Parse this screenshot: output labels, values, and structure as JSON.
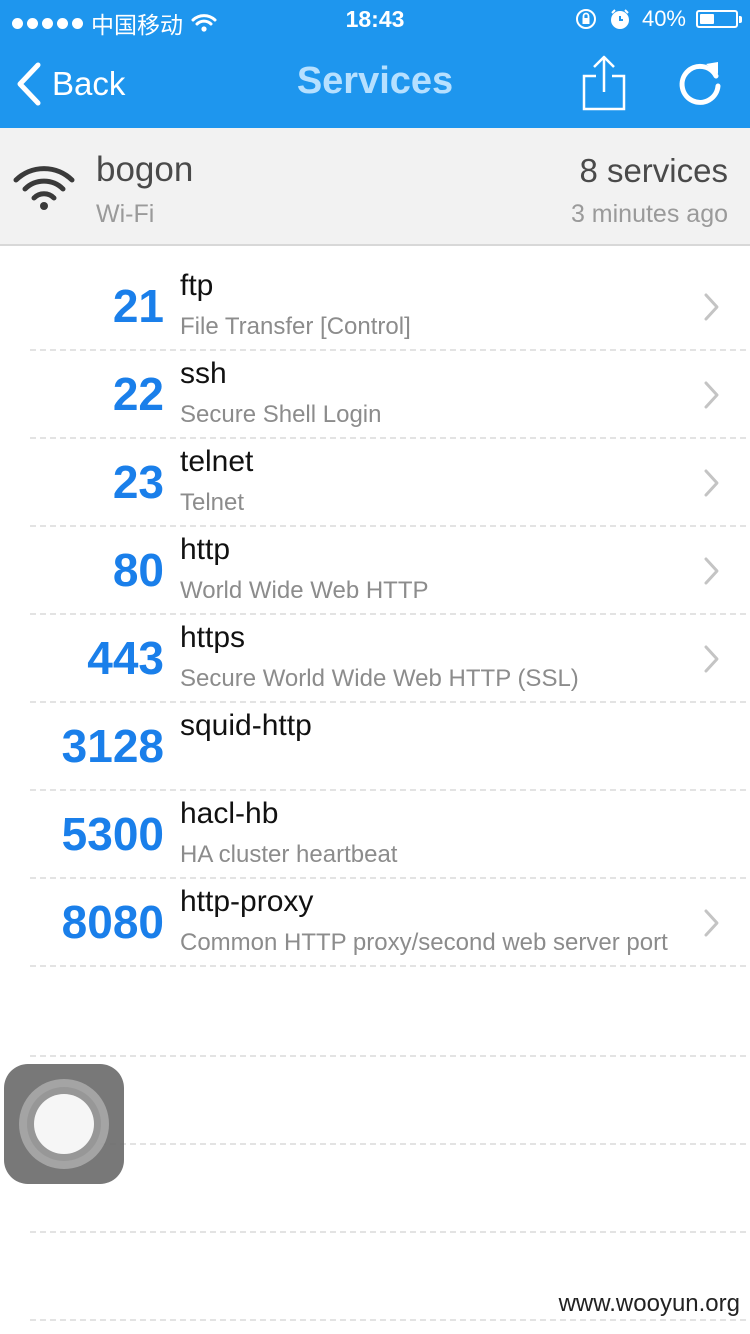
{
  "status_bar": {
    "carrier": "中国移动",
    "time": "18:43",
    "battery": "40%",
    "battery_level": 0.4
  },
  "nav": {
    "back_label": "Back",
    "title": "Services",
    "icons": [
      "chevron-left-icon",
      "share-icon",
      "refresh-icon"
    ]
  },
  "network": {
    "name": "bogon",
    "type": "Wi-Fi",
    "count": "8 services",
    "time": "3 minutes ago"
  },
  "services": [
    {
      "port": "21",
      "name": "ftp",
      "desc": "File Transfer [Control]",
      "chevron": true
    },
    {
      "port": "22",
      "name": "ssh",
      "desc": "Secure Shell Login",
      "chevron": true
    },
    {
      "port": "23",
      "name": "telnet",
      "desc": "Telnet",
      "chevron": true
    },
    {
      "port": "80",
      "name": "http",
      "desc": "World Wide Web HTTP",
      "chevron": true
    },
    {
      "port": "443",
      "name": "https",
      "desc": "Secure World Wide Web HTTP (SSL)",
      "chevron": true
    },
    {
      "port": "3128",
      "name": "squid-http",
      "desc": "",
      "chevron": false
    },
    {
      "port": "5300",
      "name": "hacl-hb",
      "desc": "HA cluster heartbeat",
      "chevron": false
    },
    {
      "port": "8080",
      "name": "http-proxy",
      "desc": "Common HTTP proxy/second web server port",
      "chevron": true
    }
  ],
  "watermark": "www.wooyun.org",
  "colors": {
    "accent": "#1e96ee",
    "port": "#1a7fea"
  }
}
